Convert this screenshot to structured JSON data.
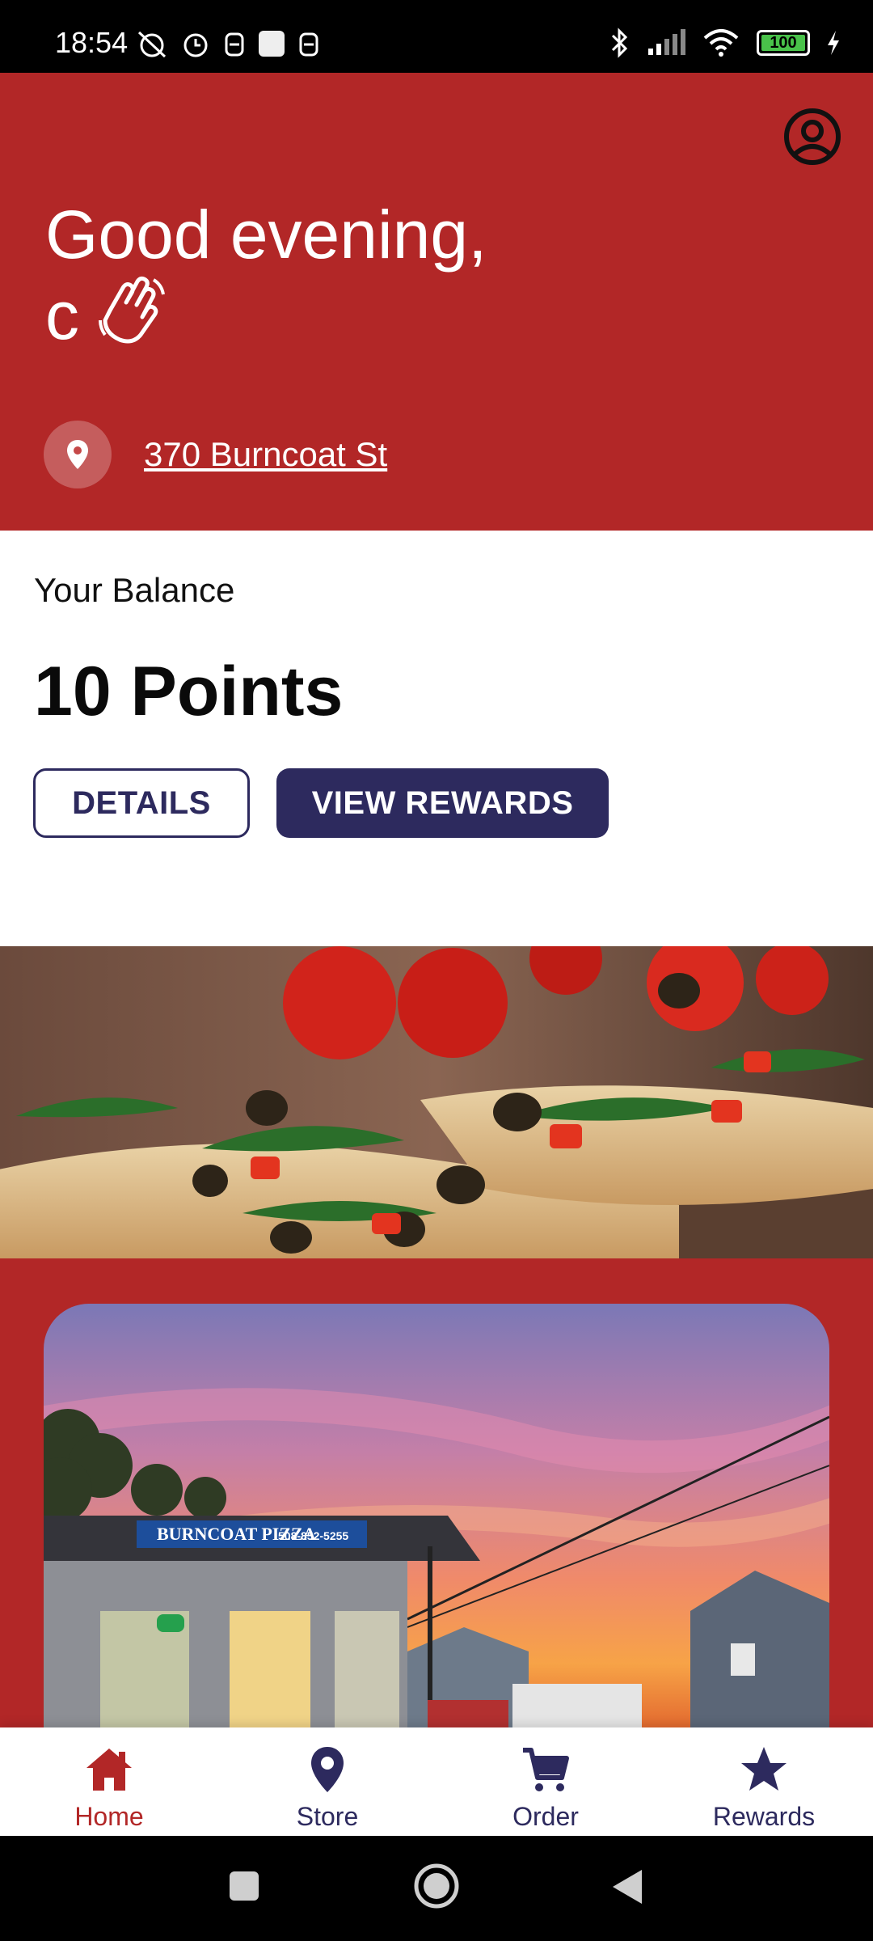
{
  "status_bar": {
    "time": "18:54",
    "battery": "100"
  },
  "header": {
    "greeting": "Good evening,",
    "user_name": "c",
    "address": "370 Burncoat St"
  },
  "balance": {
    "label": "Your Balance",
    "points": "10 Points",
    "details_label": "DETAILS",
    "view_rewards_label": "VIEW REWARDS"
  },
  "store_photo": {
    "sign_text": "BURNCOAT PIZZA",
    "sign_phone": "508-852-5255"
  },
  "nav": {
    "items": [
      {
        "label": "Home",
        "icon": "home-icon",
        "active": true
      },
      {
        "label": "Store",
        "icon": "location-pin-icon"
      },
      {
        "label": "Order",
        "icon": "cart-icon"
      },
      {
        "label": "Rewards",
        "icon": "star-icon"
      }
    ]
  },
  "colors": {
    "brand_red": "#b22727",
    "brand_navy": "#2d2a5e"
  }
}
